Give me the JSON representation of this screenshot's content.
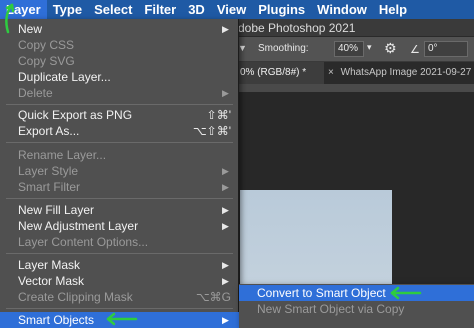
{
  "menubar": {
    "items": [
      "Layer",
      "Type",
      "Select",
      "Filter",
      "3D",
      "View",
      "Plugins",
      "Window",
      "Help"
    ]
  },
  "app": {
    "title_fragment": "dobe Photoshop 2021"
  },
  "options_bar": {
    "smoothing_label": "Smoothing:",
    "smoothing_value": "40%",
    "angle_value": "0°"
  },
  "tabs": {
    "active_label": "0% (RGB/8#) *",
    "inactive_label": "WhatsApp Image 2021-09-27",
    "close_glyph": "×"
  },
  "layer_menu": {
    "items": [
      {
        "label": "New",
        "submenu": true,
        "disabled": false
      },
      {
        "label": "Copy CSS",
        "disabled": true
      },
      {
        "label": "Copy SVG",
        "disabled": true
      },
      {
        "label": "Duplicate Layer...",
        "disabled": false
      },
      {
        "label": "Delete",
        "submenu": true,
        "disabled": true
      },
      {
        "label": "Quick Export as PNG",
        "shortcut": "⇧⌘'",
        "disabled": false
      },
      {
        "label": "Export As...",
        "shortcut": "⌥⇧⌘'",
        "disabled": false
      },
      {
        "label": "Rename Layer...",
        "disabled": true
      },
      {
        "label": "Layer Style",
        "submenu": true,
        "disabled": true
      },
      {
        "label": "Smart Filter",
        "submenu": true,
        "disabled": true
      },
      {
        "label": "New Fill Layer",
        "submenu": true,
        "disabled": false
      },
      {
        "label": "New Adjustment Layer",
        "submenu": true,
        "disabled": false
      },
      {
        "label": "Layer Content Options...",
        "disabled": true
      },
      {
        "label": "Layer Mask",
        "submenu": true,
        "disabled": false
      },
      {
        "label": "Vector Mask",
        "submenu": true,
        "disabled": false
      },
      {
        "label": "Create Clipping Mask",
        "shortcut": "⌥⌘G",
        "disabled": true
      },
      {
        "label": "Smart Objects",
        "submenu": true,
        "disabled": false,
        "highlighted": true
      }
    ]
  },
  "smart_objects_submenu": {
    "items": [
      {
        "label": "Convert to Smart Object",
        "highlighted": true
      },
      {
        "label": "New Smart Object via Copy",
        "disabled": true
      }
    ]
  },
  "colors": {
    "accent": "#2f6fd8",
    "menubar": "#1f5aa5",
    "annotation": "#2ecc40"
  }
}
